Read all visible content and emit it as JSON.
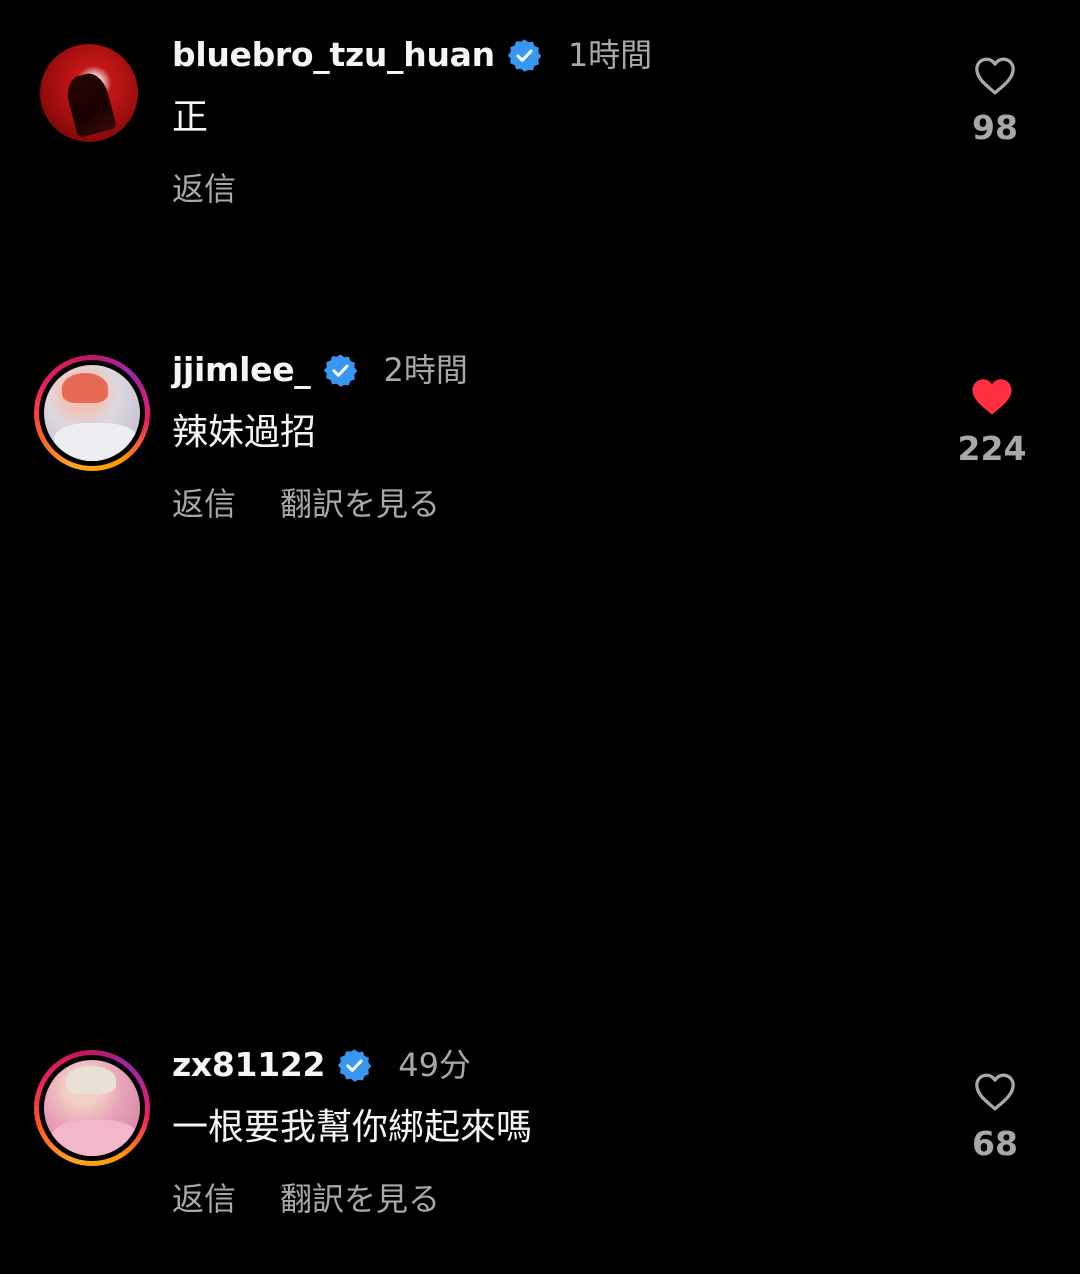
{
  "actions": {
    "reply_label": "返信",
    "translate_label": "翻訳を見る"
  },
  "colors": {
    "background": "#000000",
    "verified_badge": "#3897f0",
    "liked_heart": "#ff3040",
    "secondary_text": "#a8a8a8"
  },
  "comments": [
    {
      "username": "bluebro_tzu_huan",
      "verified": true,
      "time": "1時間",
      "text": "正",
      "like_count": "98",
      "liked": false,
      "has_story_ring": false,
      "show_translate": false
    },
    {
      "username": "jjimlee_",
      "verified": true,
      "time": "2時間",
      "text": "辣妹過招",
      "like_count": "224",
      "liked": true,
      "has_story_ring": true,
      "show_translate": true
    },
    {
      "username": "zx81122",
      "verified": true,
      "time": "49分",
      "text": "一根要我幫你綁起來嗎",
      "like_count": "68",
      "liked": false,
      "has_story_ring": true,
      "show_translate": true
    }
  ]
}
